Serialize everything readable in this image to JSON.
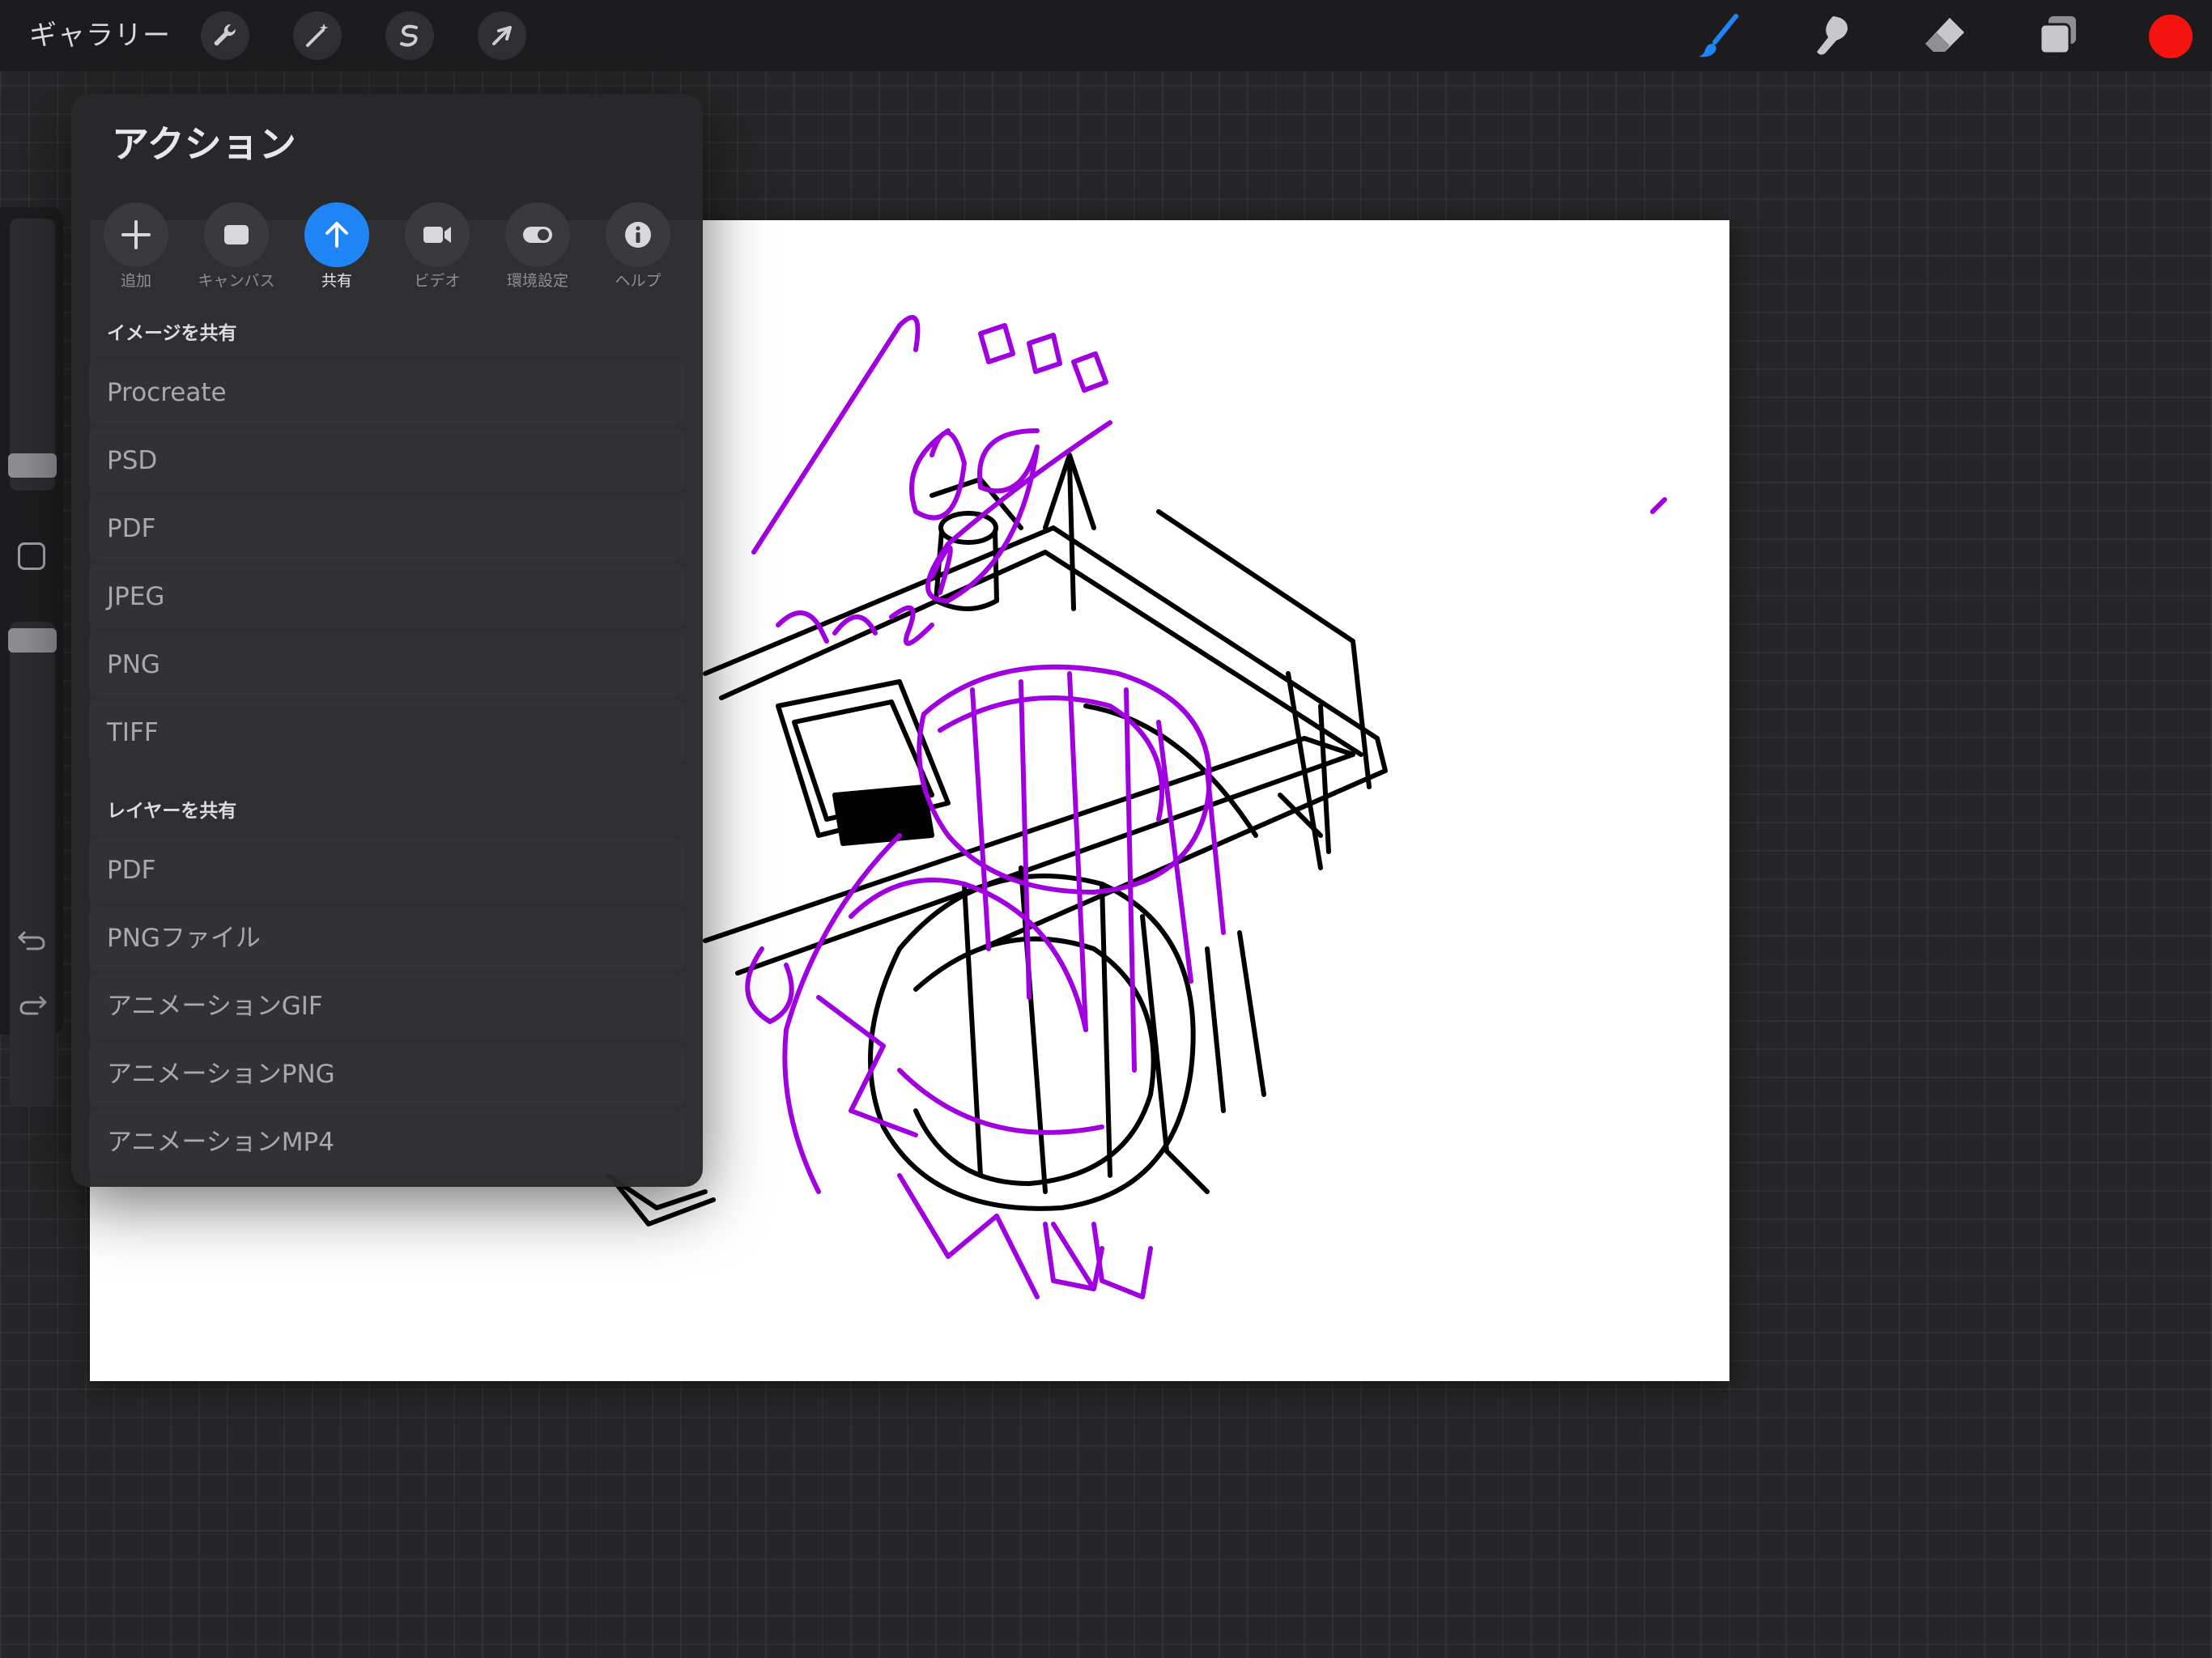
{
  "topbar": {
    "gallery_label": "ギャラリー",
    "left_tools": [
      "wrench-icon",
      "magic-wand-icon",
      "selection-icon",
      "transform-arrow-icon"
    ],
    "right_tools": [
      "brush-icon",
      "smudge-icon",
      "eraser-icon",
      "layers-icon"
    ],
    "current_color": "#f4130f",
    "active_tool_color": "#1f84f5"
  },
  "actions": {
    "title": "アクション",
    "tabs": [
      {
        "label": "追加",
        "icon": "plus-icon"
      },
      {
        "label": "キャンバス",
        "icon": "canvas-icon"
      },
      {
        "label": "共有",
        "icon": "share-arrow-icon",
        "active": true
      },
      {
        "label": "ビデオ",
        "icon": "video-camera-icon"
      },
      {
        "label": "環境設定",
        "icon": "toggle-icon"
      },
      {
        "label": "ヘルプ",
        "icon": "info-icon"
      }
    ],
    "share_image_header": "イメージを共有",
    "share_image_items": [
      "Procreate",
      "PSD",
      "PDF",
      "JPEG",
      "PNG",
      "TIFF"
    ],
    "share_layers_header": "レイヤーを共有",
    "share_layers_items": [
      "PDF",
      "PNGファイル",
      "アニメーションGIF",
      "アニメーションPNG",
      "アニメーションMP4"
    ]
  },
  "sidebar": {
    "brush_size": 0.12,
    "brush_opacity": 0.97,
    "icons": [
      "undo-icon",
      "redo-icon"
    ]
  },
  "canvas": {
    "background": "#ffffff",
    "sketch_colors": [
      "#a000e0",
      "#000000"
    ]
  }
}
